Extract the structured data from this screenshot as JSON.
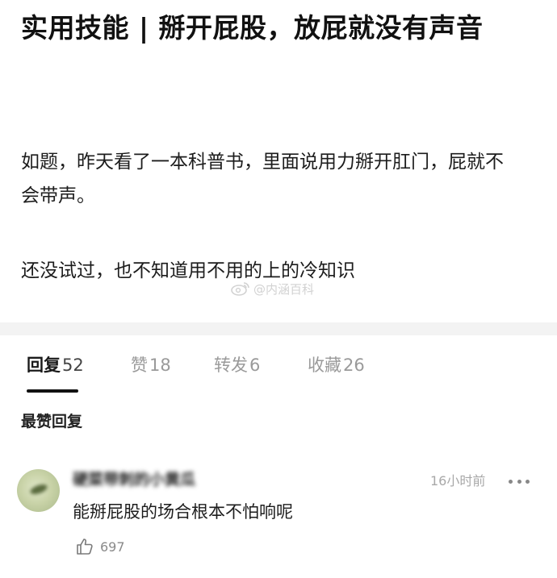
{
  "post": {
    "title": "实用技能 | 掰开屁股，放屁就没有声音",
    "paragraph_1": "如题，昨天看了一本科普书，里面说用力掰开肛门，屁就不会带声。",
    "paragraph_2": "还没试过，也不知道用不用的上的冷知识",
    "watermark": "@内涵百科"
  },
  "tabs": [
    {
      "label": "回复",
      "count": "52",
      "active": true
    },
    {
      "label": "赞",
      "count": "18",
      "active": false
    },
    {
      "label": "转发",
      "count": "6",
      "active": false
    },
    {
      "label": "收藏",
      "count": "26",
      "active": false
    }
  ],
  "section_title": "最赞回复",
  "comment": {
    "nickname": "硬菜带刺的小黄瓜",
    "time": "16小时前",
    "text": "能掰屁股的场合根本不怕响呢",
    "likes": "697"
  },
  "colors": {
    "band": "#f3f3f3",
    "muted": "#9a9a9a",
    "active_tab": "#1a1a1a"
  },
  "icons": {
    "more": "more-dots-icon",
    "like": "thumbs-up-icon",
    "watermark": "weibo-icon"
  }
}
